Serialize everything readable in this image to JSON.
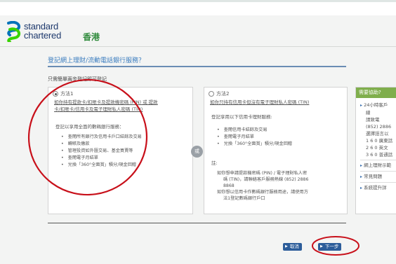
{
  "brand": {
    "name_line1": "standard",
    "name_line2": "chartered",
    "region": "香港",
    "logo_colors": [
      "#0472b9",
      "#38d200"
    ]
  },
  "page": {
    "title": "登記網上理財/流動電話銀行服務？",
    "note": "只需簡單兩步登記即可登記"
  },
  "option1": {
    "label": "方法1",
    "description_line1": "如你持有提款卡/扣賬卡及提款機密碼 (PIN) 或 提款",
    "description_line2": "卡/扣賬卡/信用卡及電子理財私人密碼 (TIN)",
    "services_title": "登記以享用全面的數碼銀行服務：",
    "services": [
      "查閱所有銀行及信用卡戶口結餘及交易",
      "轉賬及繳款",
      "管理投資如外匯交易、基金買賣等",
      "查閱電子月結單",
      "兌換「360°全面賞」積分/現金回贈"
    ]
  },
  "or_label": "或",
  "option2": {
    "label": "方法2",
    "description": "如你只持有信用卡但沒有電子理財私人密碼 (TIN)",
    "services_title": "登記享用以下信用卡理財服務:",
    "services": [
      "查閱信用卡結餘及交易",
      "查閱電子月結單",
      "兌換「360°全面賞」積分/現金回贈"
    ],
    "remark_label": "註:",
    "remarks": [
      "如你想申請提款機密碼 (PIN) / 電子理財私人密",
      "碼 (TIN)，請聯絡客戶服務熱線 (852) 2886",
      "8868",
      "如你想以信用卡作數碼銀行服務用途，請使用方",
      "法1登記數碼銀行戶口"
    ]
  },
  "buttons": {
    "cancel": "取消",
    "next": "下一步"
  },
  "help": {
    "title": "需要協助?",
    "hotline_label": "24小時客戶",
    "hotline_label2": "線",
    "call_label": "請致電",
    "phone": "(852) 2886",
    "language_label": "選擇語言以",
    "lang1": "1 6 0 廣東話",
    "lang2": "2 6 0 英文",
    "lang3": "3 6 0 普通話",
    "link1": "網上理財示範",
    "link2": "常見問題",
    "link3": "系統提升詳"
  }
}
